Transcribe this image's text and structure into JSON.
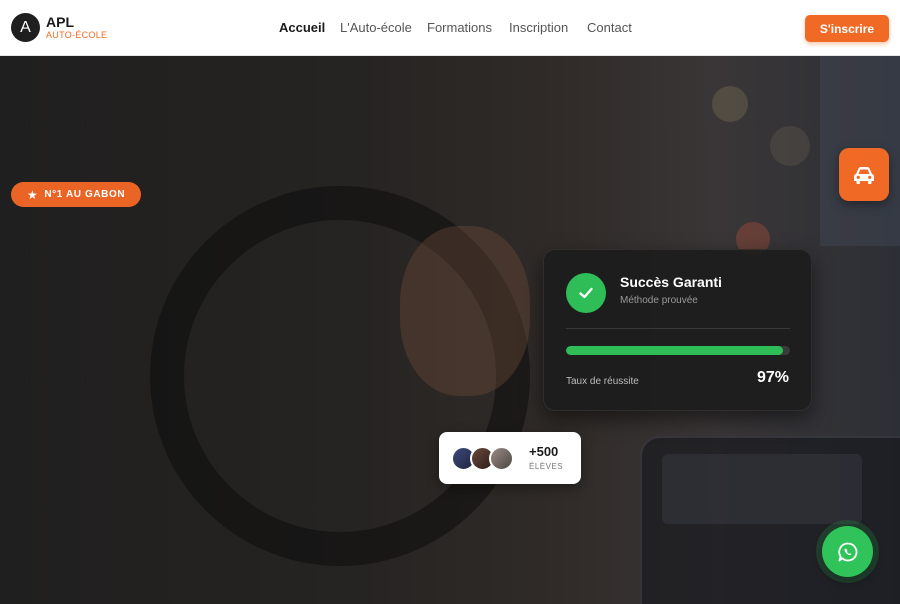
{
  "brand": {
    "logo_letter": "A",
    "name": "APL",
    "subtitle": "AUTO-ÉCOLE",
    "accent": "#f06a25"
  },
  "nav": {
    "items": [
      {
        "label": "Accueil",
        "active": true
      },
      {
        "label": "L'Auto-école",
        "active": false
      },
      {
        "label": "Formations",
        "active": false
      },
      {
        "label": "Inscription",
        "active": false
      },
      {
        "label": "Contact",
        "active": false
      }
    ],
    "cta_label": "S'inscrire"
  },
  "hero": {
    "badge": {
      "icon": "star-icon",
      "label": "N°1 AU GABON"
    },
    "side_button_icon": "car-icon"
  },
  "success_card": {
    "icon": "checkmark-icon",
    "title": "Succès Garanti",
    "subtitle": "Méthode prouvée",
    "progress_label": "Taux de réussite",
    "progress_value": "97%",
    "progress_fraction": 0.97,
    "success_color": "#2fbd58"
  },
  "students": {
    "count": "+500",
    "label": "ÉLÈVES"
  },
  "whatsapp": {
    "icon": "whatsapp-icon",
    "color": "#2fc35a"
  }
}
